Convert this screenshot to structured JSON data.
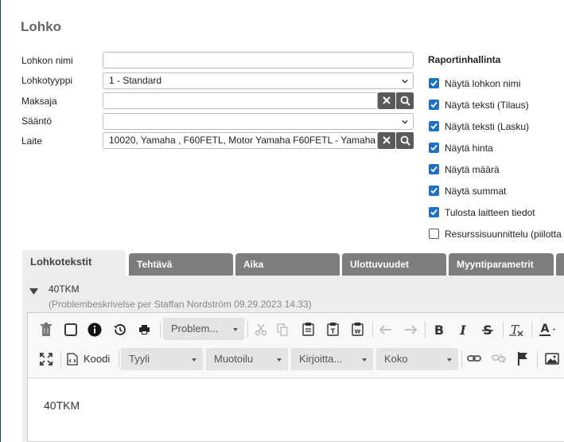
{
  "form": {
    "title": "Lohko",
    "fields": [
      {
        "label": "Lohkon nimi",
        "value": ""
      },
      {
        "label": "Lohkotyyppi",
        "value": "1 - Standard"
      },
      {
        "label": "Maksaja",
        "value": ""
      },
      {
        "label": "Sääntö",
        "value": ""
      },
      {
        "label": "Laite",
        "value": "10020, Yamaha , F60FETL, Motor Yamaha F60FETL - Yamaha"
      }
    ]
  },
  "report": {
    "heading": "Raportinhallinta",
    "options": [
      {
        "label": "Näytä lohkon nimi",
        "checked": true
      },
      {
        "label": "Näytä teksti (Tilaus)",
        "checked": true
      },
      {
        "label": "Näytä teksti (Lasku)",
        "checked": true
      },
      {
        "label": "Näytä hinta",
        "checked": true
      },
      {
        "label": "Näytä määrä",
        "checked": true
      },
      {
        "label": "Näytä summat",
        "checked": true
      },
      {
        "label": "Tulosta laitteen tiedot",
        "checked": true
      },
      {
        "label": "Resurssisuunnittelu (piilotta",
        "checked": false
      }
    ]
  },
  "tabs": [
    "Lohkotekstit",
    "Tehtävä",
    "Aika",
    "Ulottuvuudet",
    "Myyntiparametrit"
  ],
  "block": {
    "title": "40TKM",
    "subtitle": "(Problembeskrivelse per Staffan Nordström 09.29.2023 14.33)"
  },
  "toolbar": {
    "template_combo": "Problem...",
    "source_label": "Koodi",
    "style_combo": "Tyyli",
    "format_combo": "Muotoilu",
    "font_combo": "Kirjoitta...",
    "size_combo": "Koko"
  },
  "editor": {
    "content": "40TKM"
  },
  "colors": {
    "checkbox": "#1a73c8",
    "tab_inactive": "#7d7d7d",
    "button_dark": "#5a5a5a"
  }
}
